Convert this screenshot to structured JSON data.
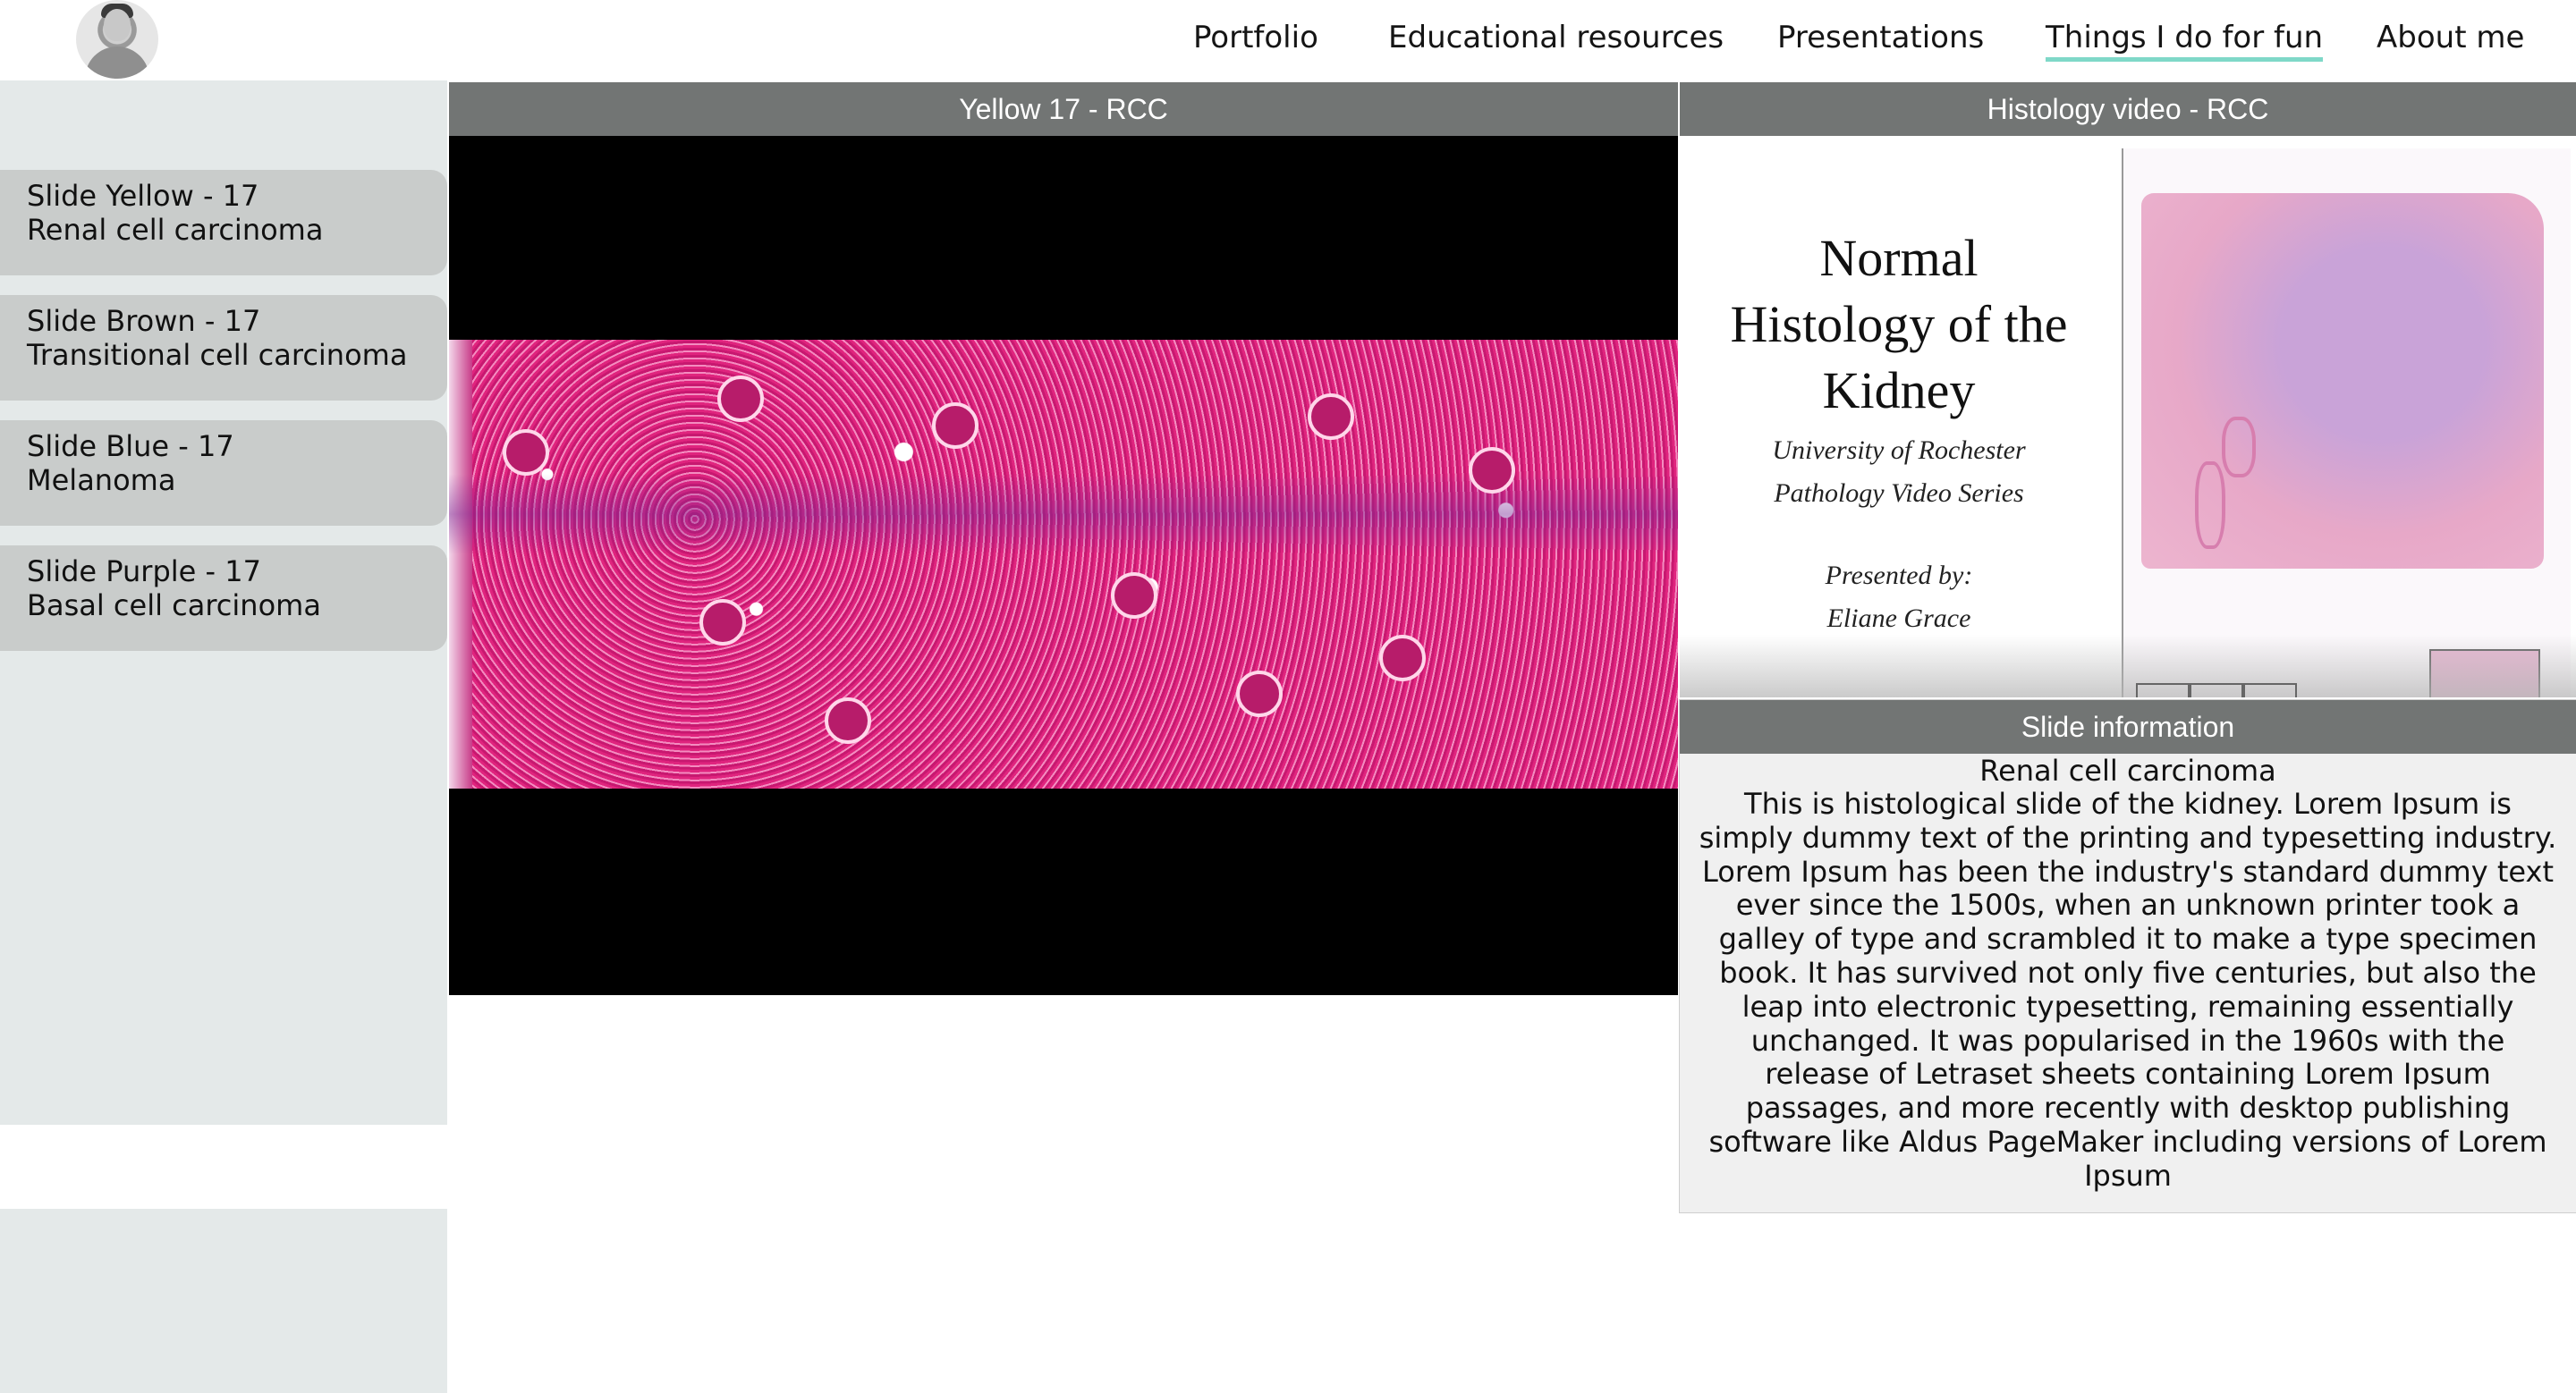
{
  "header": {
    "avatar": "profile-photo",
    "nav": [
      {
        "label": "Portfolio"
      },
      {
        "label": "Educational resources"
      },
      {
        "label": "Presentations"
      },
      {
        "label": "Things I do for fun",
        "active": true
      },
      {
        "label": "About me"
      }
    ],
    "active_color": "#7fd8c8"
  },
  "sidebar": {
    "items": [
      {
        "title": "Slide Yellow - 17",
        "subtitle": "Renal cell carcinoma"
      },
      {
        "title": "Slide Brown - 17",
        "subtitle": "Transitional cell carcinoma"
      },
      {
        "title": "Slide Blue - 17",
        "subtitle": "Melanoma"
      },
      {
        "title": "Slide Purple - 17",
        "subtitle": "Basal cell carcinoma"
      }
    ]
  },
  "viewer": {
    "title": "Yellow 17 - RCC"
  },
  "video": {
    "title": "Histology video - RCC",
    "card_title_lines": [
      "Normal",
      "Histology of the",
      "Kidney"
    ],
    "card_subtitle_lines": [
      "University of Rochester",
      "Pathology Video Series"
    ],
    "card_presenter_lines": [
      "Presented by:",
      "Eliane Grace"
    ]
  },
  "info": {
    "title": "Slide information",
    "heading": "Renal cell carcinoma",
    "body": "This is histological slide of the kidney. Lorem Ipsum is simply dummy text of the printing and typesetting industry. Lorem Ipsum has been the industry's standard dummy text ever since the 1500s, when an unknown printer took a galley of type and scrambled it to make a type specimen book. It has survived not only five centuries, but also the leap into electronic typesetting, remaining essentially unchanged. It was popularised in the 1960s with the release of Letraset sheets containing Lorem Ipsum passages, and more recently with desktop publishing software like Aldus PageMaker including versions of Lorem Ipsum"
  },
  "colors": {
    "sidebar_bg": "#e4e9e9",
    "sidebar_item_bg": "#c9cccb",
    "panel_header_bg": "#727574",
    "info_bg": "#f0f0f0",
    "tissue_pink": "#d6206f"
  }
}
